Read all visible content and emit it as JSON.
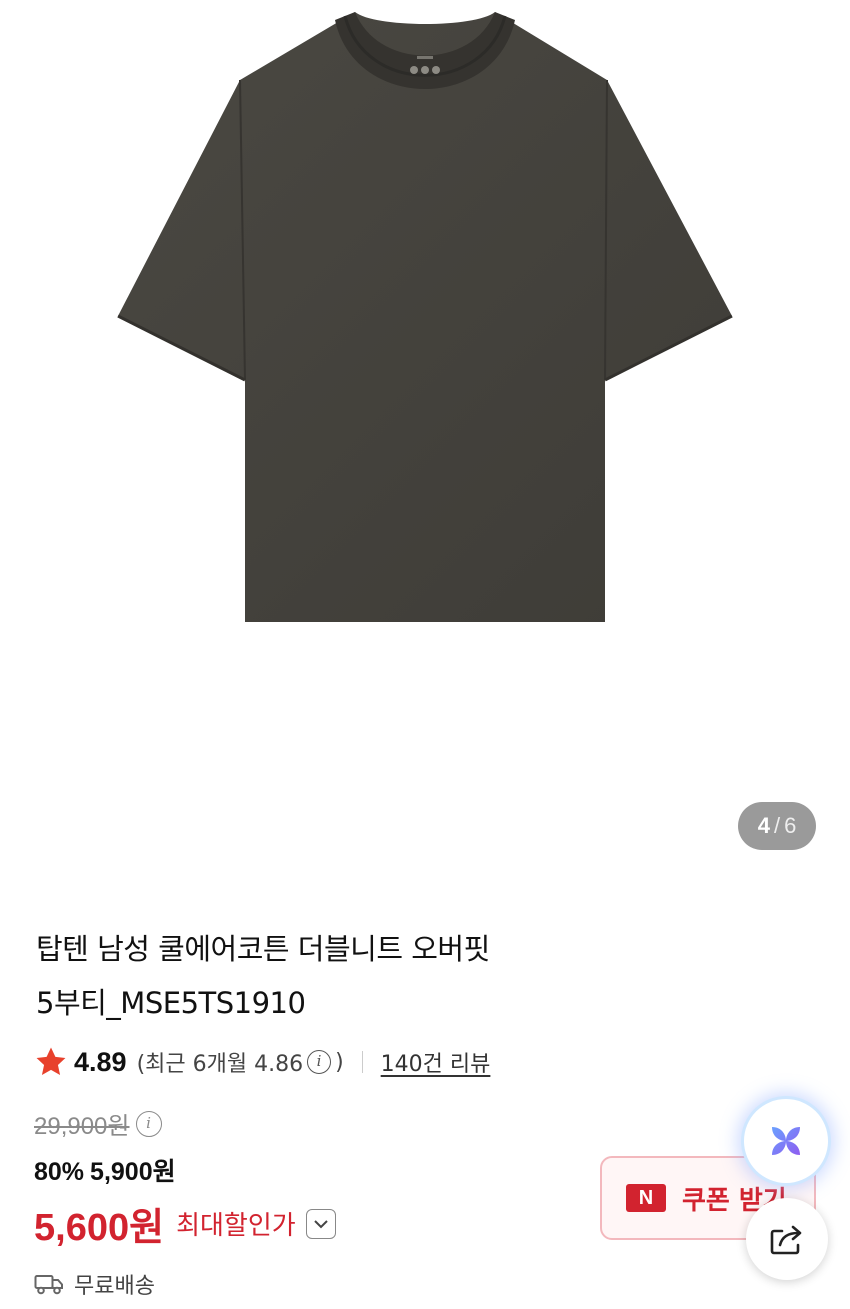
{
  "gallery": {
    "current": "4",
    "separator": "/",
    "total": "6",
    "image_icon": "tshirt-product-image"
  },
  "product": {
    "title_line1": "탑텐 남성 쿨에어코튼 더블니트 오버핏",
    "title_line2": "5부티_MSE5TS1910"
  },
  "rating": {
    "score": "4.89",
    "recent_prefix": "(최근 6개월 4.86",
    "recent_suffix": ")",
    "review_link": "140건 리뷰",
    "star_color": "#e8412c"
  },
  "price": {
    "original": "29,900원",
    "discount_rate": "80%",
    "sale_price": "5,900원",
    "max_price": "5,600원",
    "max_label": "최대할인가",
    "accent_color": "#d2232f"
  },
  "shipping": {
    "label": "무료배송",
    "icon": "truck-icon"
  },
  "coupon": {
    "badge": "N",
    "label": "쿠폰 받기"
  },
  "fabs": {
    "ai_icon": "ai-assistant-icon",
    "share_icon": "share-icon"
  },
  "info_glyph": "i"
}
